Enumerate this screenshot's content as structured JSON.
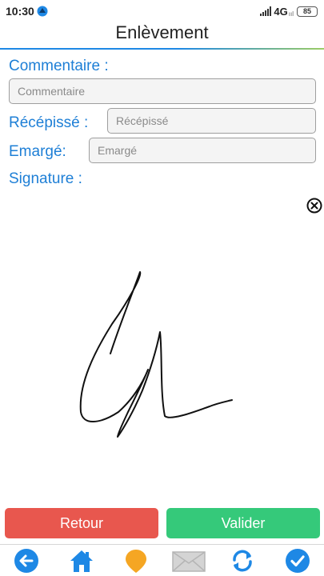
{
  "status_bar": {
    "time": "10:30",
    "network": "4G",
    "network_sub": "ııl",
    "battery": "85"
  },
  "header": {
    "title": "Enlèvement"
  },
  "form": {
    "commentaire": {
      "label": "Commentaire :",
      "placeholder": "Commentaire",
      "value": ""
    },
    "recepisse": {
      "label": "Récépissé :",
      "placeholder": "Récépissé",
      "value": ""
    },
    "emarge": {
      "label": "Emargé:",
      "placeholder": "Emargé",
      "value": ""
    },
    "signature": {
      "label": "Signature :"
    }
  },
  "actions": {
    "retour": "Retour",
    "valider": "Valider"
  },
  "bottom_nav": {
    "items": [
      "back-icon",
      "home-icon",
      "location-pin-icon",
      "mail-icon",
      "sync-icon",
      "check-icon"
    ]
  },
  "colors": {
    "accent": "#1e7fd6",
    "retour": "#e8574e",
    "valider": "#35c97a",
    "nav_blue": "#1e88e5",
    "pin_orange": "#f5a623",
    "mail_gray": "#c8c8c8"
  }
}
